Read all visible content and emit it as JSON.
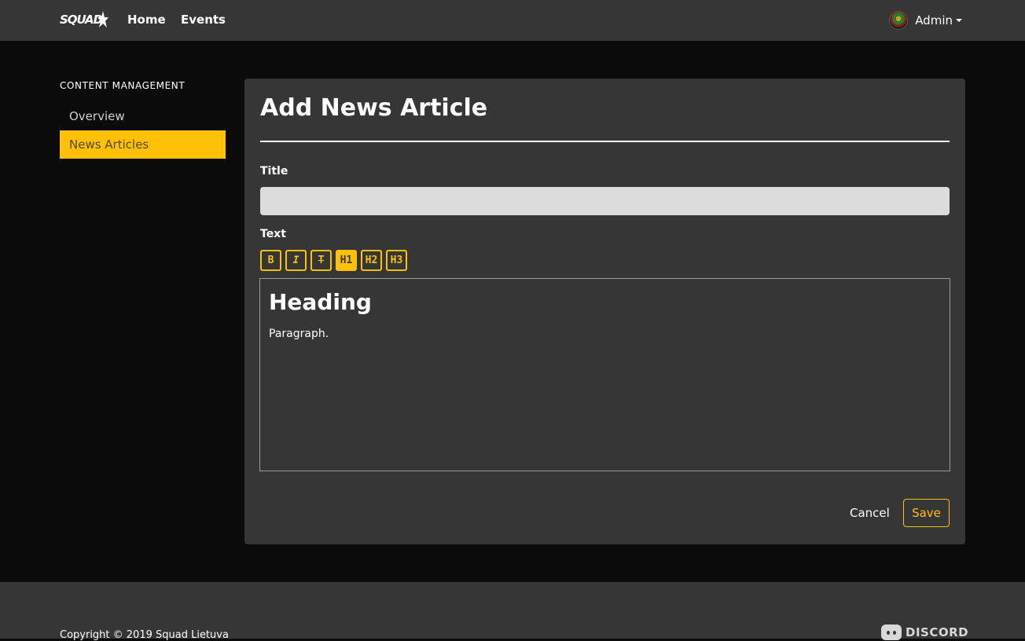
{
  "navbar": {
    "brand": "SQUAD",
    "links": [
      {
        "label": "Home"
      },
      {
        "label": "Events"
      }
    ],
    "user": {
      "name": "Admin"
    }
  },
  "sidebar": {
    "heading": "CONTENT MANAGEMENT",
    "items": [
      {
        "label": "Overview",
        "active": false
      },
      {
        "label": "News Articles",
        "active": true
      }
    ]
  },
  "form": {
    "page_title": "Add News Article",
    "title_label": "Title",
    "title_value": "",
    "text_label": "Text",
    "toolbar": [
      {
        "label": "B",
        "icon": "bold-icon",
        "active": false
      },
      {
        "label": "I",
        "icon": "italic-icon",
        "active": false
      },
      {
        "label": "T",
        "icon": "strikethrough-icon",
        "active": false
      },
      {
        "label": "H1",
        "icon": "heading-1-icon",
        "active": true
      },
      {
        "label": "H2",
        "icon": "heading-2-icon",
        "active": false
      },
      {
        "label": "H3",
        "icon": "heading-3-icon",
        "active": false
      }
    ],
    "editor": {
      "heading": "Heading",
      "paragraph": "Paragraph."
    },
    "cancel_label": "Cancel",
    "save_label": "Save"
  },
  "footer": {
    "copyright": "Copyright © 2019 Squad Lietuva",
    "discord_label": "DISCORD"
  },
  "colors": {
    "accent": "#ffc107",
    "background": "#0b0b0b",
    "surface": "#363636"
  }
}
